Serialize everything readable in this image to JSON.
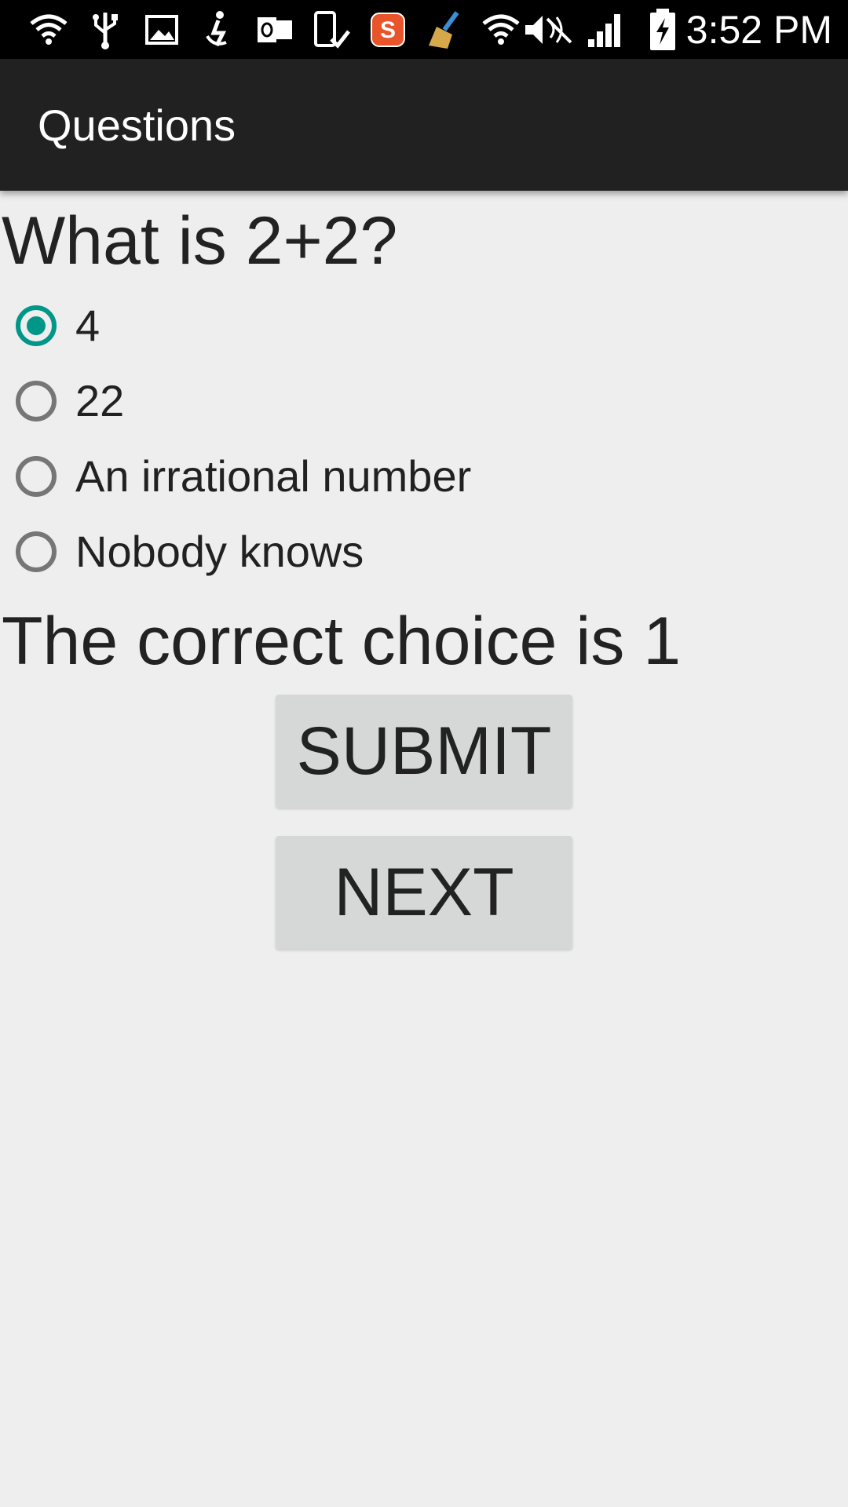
{
  "status_bar": {
    "time": "3:52 PM",
    "left_icons": [
      "wifi-icon",
      "usb-icon",
      "image-icon",
      "accessibility-icon",
      "outlook-icon",
      "phone-check-icon",
      "s-app-icon",
      "broom-icon",
      "wifi-icon"
    ],
    "right_icons": [
      "mute-icon",
      "signal-icon",
      "battery-charging-icon"
    ]
  },
  "app_bar": {
    "title": "Questions"
  },
  "quiz": {
    "question": "What is 2+2?",
    "options": [
      {
        "label": "4",
        "checked": true
      },
      {
        "label": "22",
        "checked": false
      },
      {
        "label": "An irrational number",
        "checked": false
      },
      {
        "label": "Nobody knows",
        "checked": false
      }
    ],
    "result": "The correct choice is 1",
    "submit_label": "SUBMIT",
    "next_label": "NEXT"
  },
  "colors": {
    "accent": "#009688",
    "app_bar": "#212121",
    "background": "#eeeeee",
    "button": "#d6d7d7"
  }
}
